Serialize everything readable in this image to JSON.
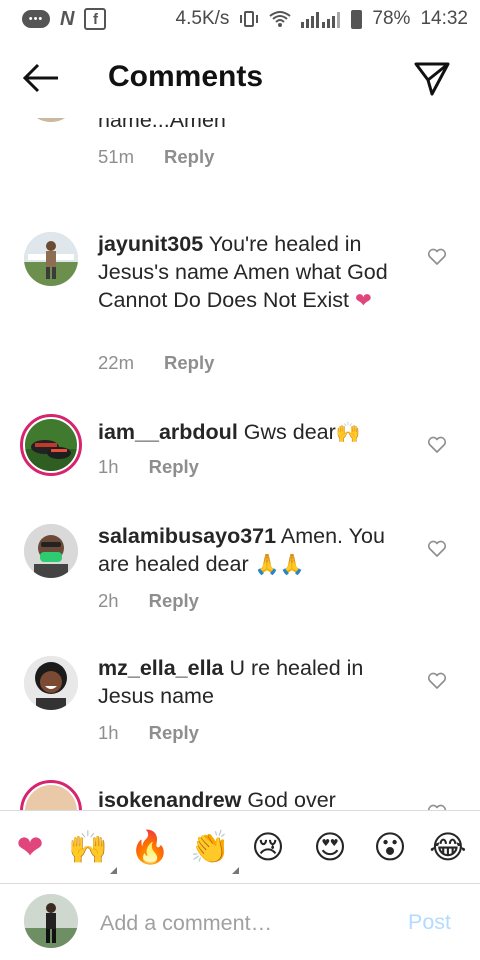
{
  "status_bar": {
    "speed": "4.5K/s",
    "battery": "78%",
    "time": "14:32"
  },
  "header": {
    "title": "Comments"
  },
  "comments": [
    {
      "username": "",
      "text": "name...Amen",
      "time": "51m",
      "reply_label": "Reply"
    },
    {
      "username": "jayunit305",
      "text": "You're healed in Jesus's name Amen what God Cannot Do Does Not Exist",
      "emoji": "❤",
      "time": "22m",
      "reply_label": "Reply"
    },
    {
      "username": "iam__arbdoul",
      "text": "Gws dear",
      "emoji": "🙌",
      "time": "1h",
      "reply_label": "Reply"
    },
    {
      "username": "salamibusayo371",
      "text": "Amen. You are healed dear",
      "emoji": "🙏🙏",
      "time": "2h",
      "reply_label": "Reply"
    },
    {
      "username": "mz_ella_ella",
      "text": "U re healed in Jesus name",
      "time": "1h",
      "reply_label": "Reply"
    },
    {
      "username": "isokenandrew",
      "text": "God over"
    }
  ],
  "reactions": [
    "❤",
    "🙌",
    "🔥",
    "👏",
    "😢",
    "😍",
    "😮",
    "😂"
  ],
  "composer": {
    "placeholder": "Add a comment…",
    "post_label": "Post"
  },
  "colors": {
    "story_ring": "#d6246e",
    "heart": "#e0457b",
    "muted": "#8e8e8e",
    "post_disabled": "#b3dbff"
  }
}
